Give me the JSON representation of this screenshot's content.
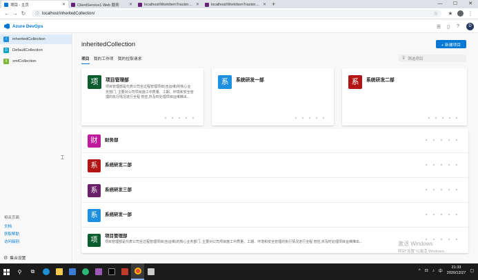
{
  "browser": {
    "tabs": [
      {
        "title": "项目 - 主页",
        "active": true,
        "icon": "azure-devops-icon"
      },
      {
        "title": "ClientService1 Web 服务",
        "active": false,
        "icon": "vs-icon"
      },
      {
        "title": "localhost/WorkItemTracking/...",
        "active": false,
        "icon": "vs-icon"
      },
      {
        "title": "localhost/WorkItemTracking/...",
        "active": false,
        "icon": "vs-icon"
      }
    ],
    "new_tab": "+",
    "url": "localhost/inheritedCollection/",
    "window_controls": [
      "—",
      "☐",
      "✕"
    ]
  },
  "header": {
    "product": "Azure DevOps",
    "user_initial": "D"
  },
  "sidebar": {
    "collections": [
      {
        "letter": "I",
        "name": "inheritedCollection",
        "color": "#1e90e0",
        "selected": true
      },
      {
        "letter": "D",
        "name": "DefaultCollection",
        "color": "#0fa3c9",
        "selected": false
      },
      {
        "letter": "X",
        "name": "xmlCollection",
        "color": "#7db832",
        "selected": false
      }
    ],
    "related_caption": "相关页面",
    "links": [
      "文档",
      "获取帮助",
      "访问级别"
    ],
    "org_settings": "集合设置"
  },
  "main": {
    "collection_title": "inheritedCollection",
    "new_project_label": "+ 新建项目",
    "pivots": [
      "项目",
      "我的工作项",
      "我的拉取请求"
    ],
    "filter_placeholder": "筛选项目",
    "cards": [
      {
        "tile": "项",
        "name": "项目管理部",
        "color": "#0b5d2f",
        "desc": "项目管理部是代表公司全过程管理项目(含运维)的核心业务部门, 主要对公司项目施工中质量、工期、环境和安全管理的执行情况进行全程 管控,并及时处理项目运维推出..."
      },
      {
        "tile": "系",
        "name": "系统研发一部",
        "color": "#1e90e0",
        "desc": ""
      },
      {
        "tile": "系",
        "name": "系统研发二部",
        "color": "#b31515",
        "desc": ""
      }
    ],
    "rows": [
      {
        "tile": "财",
        "name": "财务部",
        "color": "#c21a9c",
        "desc": ""
      },
      {
        "tile": "系",
        "name": "系统研发二部",
        "color": "#b31515",
        "desc": ""
      },
      {
        "tile": "系",
        "name": "系统研发三部",
        "color": "#6b1f6b",
        "desc": ""
      },
      {
        "tile": "系",
        "name": "系统研发一部",
        "color": "#1e90e0",
        "desc": ""
      },
      {
        "tile": "项",
        "name": "项目管理部",
        "color": "#0b5d2f",
        "desc": "项目管理部是代表公司全过程管理项目(含运维)的核心业务部门, 主要对公司项目施工中质量、工期、环境和安全管理的执行情况进行全程 管控,并及时处理项目运维推出..."
      }
    ]
  },
  "watermark": {
    "line1": "激活 Windows",
    "line2": "转到\"设置\"以激活 Windows。"
  },
  "taskbar": {
    "time": "21:33",
    "date": "2020/12/27",
    "lang": "中"
  }
}
